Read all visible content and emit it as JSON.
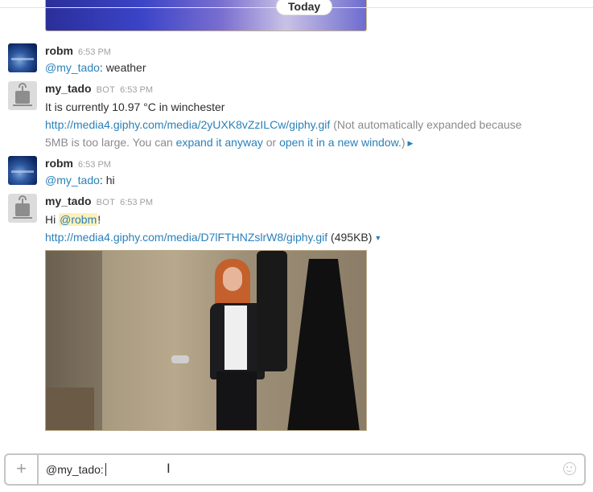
{
  "day_divider": {
    "label": "Today"
  },
  "messages": [
    {
      "author": "robm",
      "time": "6:53 PM",
      "mention": "@my_tado",
      "text": ": weather"
    },
    {
      "author": "my_tado",
      "bot_tag": "BOT",
      "time": "6:53 PM",
      "text": "It is currently 10.97 °C in winchester",
      "link": "http://media4.giphy.com/media/2yUXK8vZzILCw/giphy.gif",
      "notice_1": "(Not automatically expanded because",
      "notice_2": "5MB is too large. You can",
      "expand_link": "expand it anyway",
      "or_text": "or",
      "open_link": "open it in a new window.",
      "close_paren": ")"
    },
    {
      "author": "robm",
      "time": "6:53 PM",
      "mention": "@my_tado",
      "text": ": hi"
    },
    {
      "author": "my_tado",
      "bot_tag": "BOT",
      "time": "6:53 PM",
      "greeting": "Hi",
      "mention": "@robm",
      "punct": "!",
      "link": "http://media4.giphy.com/media/D7lFTHNZslrW8/giphy.gif",
      "size": "(495KB)"
    }
  ],
  "composer": {
    "value": "@my_tado:",
    "plus_label": "+"
  },
  "colors": {
    "link": "#2a80b9",
    "mention_highlight": "#fdf0b8",
    "text": "#2c2d30",
    "muted": "#a0a0a2"
  }
}
